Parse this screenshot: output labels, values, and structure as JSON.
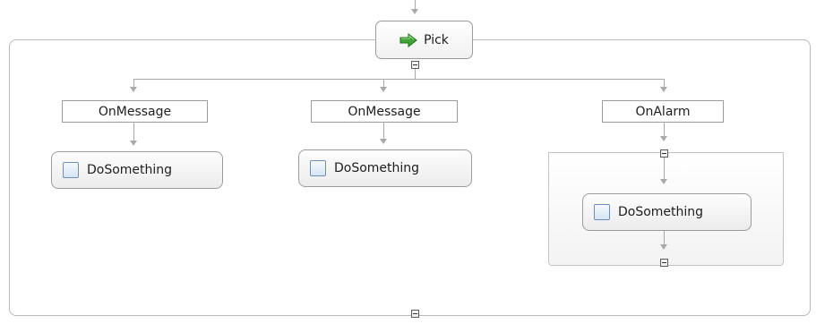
{
  "pick": {
    "label": "Pick",
    "icon": "green-right-arrow-icon"
  },
  "branches": [
    {
      "kind": "OnMessage",
      "label": "OnMessage",
      "activity": {
        "label": "DoSomething",
        "icon": "activity-box-icon"
      }
    },
    {
      "kind": "OnMessage",
      "label": "OnMessage",
      "activity": {
        "label": "DoSomething",
        "icon": "activity-box-icon"
      }
    },
    {
      "kind": "OnAlarm",
      "label": "OnAlarm",
      "activity": {
        "label": "DoSomething",
        "icon": "activity-box-icon"
      }
    }
  ],
  "colors": {
    "wire": "#a9a9a9",
    "node_border": "#9c9c9c",
    "frame_border": "#b9b9b9",
    "pick_arrow_green": "#3fa535",
    "activity_icon_blue": "#6f8fb3"
  }
}
